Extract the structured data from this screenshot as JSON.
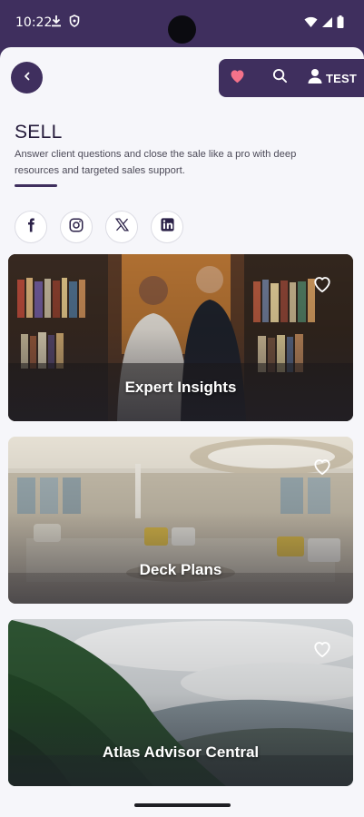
{
  "status_bar": {
    "time": "10:22",
    "left_icons": [
      "download-icon",
      "shield-icon"
    ],
    "right_icons": [
      "wifi-icon",
      "signal-icon",
      "battery-icon"
    ]
  },
  "header": {
    "back_icon": "chevron-left-icon",
    "favorites_icon": "heart-icon",
    "favorites_color": "#f4728a",
    "search_icon": "search-icon",
    "user_icon": "person-icon",
    "user_label": "TEST"
  },
  "page": {
    "title": "SELL",
    "description": "Answer client questions and close the sale like a pro with deep resources and targeted sales support."
  },
  "social": [
    {
      "name": "facebook",
      "icon": "facebook-icon"
    },
    {
      "name": "instagram",
      "icon": "instagram-icon"
    },
    {
      "name": "x",
      "icon": "x-icon"
    },
    {
      "name": "linkedin",
      "icon": "linkedin-icon"
    }
  ],
  "cards": [
    {
      "title": "Expert Insights",
      "favorite_icon": "heart-outline-icon"
    },
    {
      "title": "Deck Plans",
      "favorite_icon": "heart-outline-icon"
    },
    {
      "title": "Atlas Advisor Central",
      "favorite_icon": "heart-outline-icon"
    }
  ],
  "colors": {
    "brand_purple": "#3f2f5e",
    "background": "#f6f6fa",
    "accent_pink": "#f4728a"
  }
}
